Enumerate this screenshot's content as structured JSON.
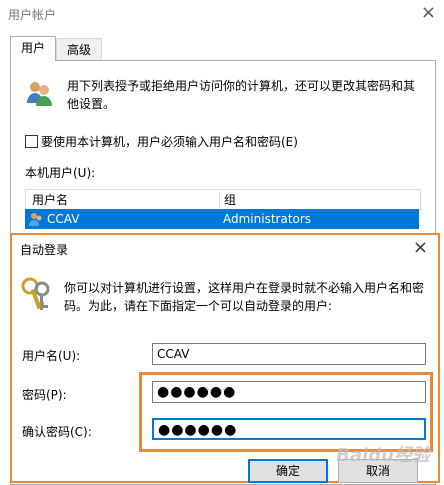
{
  "background_window": {
    "title": "用户帐户",
    "close_glyph": "×",
    "tabs": [
      {
        "label": "用户",
        "active": true
      },
      {
        "label": "高级",
        "active": false
      }
    ],
    "intro_text": "用下列表授予或拒绝用户访问你的计算机，还可以更改其密码和其他设置。",
    "require_login_checkbox": {
      "label": "要使用本计算机，用户必须输入用户名和密码(E)",
      "checked": false
    },
    "local_users_label": "本机用户(U):",
    "table": {
      "columns": [
        "用户名",
        "组"
      ],
      "rows": [
        {
          "name": "CCAV",
          "group": "Administrators",
          "selected": true
        }
      ]
    }
  },
  "autologon_dialog": {
    "title": "自动登录",
    "close_glyph": "×",
    "description": "你可以对计算机进行设置，这样用户在登录时就不必输入用户名和密码。为此，请在下面指定一个可以自动登录的用户:",
    "fields": {
      "username": {
        "label": "用户名(U):",
        "value": "CCAV"
      },
      "password": {
        "label": "密码(P):",
        "value": "●●●●●●"
      },
      "confirm": {
        "label": "确认密码(C):",
        "value": "●●●●●●"
      }
    },
    "buttons": {
      "ok": "确定",
      "cancel": "取消"
    },
    "highlight_color": "#e98a3b",
    "accent_color": "#0078d7"
  },
  "watermark": "Baidu经验"
}
